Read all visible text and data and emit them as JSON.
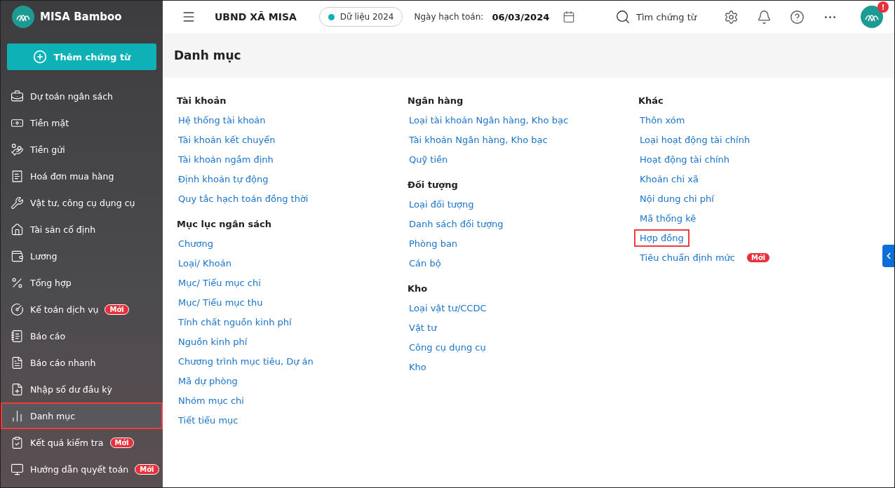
{
  "sidebar": {
    "brand": "MISA Bamboo",
    "add_button": "Thêm chứng từ",
    "items": [
      {
        "label": "Dự toán ngân sách",
        "selected": false,
        "highlighted": false
      },
      {
        "label": "Tiền mặt",
        "selected": false,
        "highlighted": false
      },
      {
        "label": "Tiền gửi",
        "selected": false,
        "highlighted": false
      },
      {
        "label": "Hoá đơn mua hàng",
        "selected": false,
        "highlighted": false
      },
      {
        "label": "Vật tư, công cụ dụng cụ",
        "selected": false,
        "highlighted": false
      },
      {
        "label": "Tài sản cố định",
        "selected": false,
        "highlighted": false
      },
      {
        "label": "Lương",
        "selected": false,
        "highlighted": false
      },
      {
        "label": "Tổng hợp",
        "selected": false,
        "highlighted": false
      },
      {
        "label": "Kế toán dịch vụ",
        "badge": "Mới",
        "selected": false,
        "highlighted": false
      },
      {
        "label": "Báo cáo",
        "selected": false,
        "highlighted": false
      },
      {
        "label": "Báo cáo nhanh",
        "selected": false,
        "highlighted": false
      },
      {
        "label": "Nhập số dư đầu kỳ",
        "selected": false,
        "highlighted": false
      },
      {
        "label": "Danh mục",
        "selected": true,
        "highlighted": true
      },
      {
        "label": "Kết quả kiểm tra",
        "badge": "Mới",
        "selected": false,
        "highlighted": false
      },
      {
        "label": "Hướng dẫn quyết toán",
        "badge": "Mới",
        "selected": false,
        "highlighted": false
      }
    ]
  },
  "header": {
    "org": "UBND XÃ MISA",
    "data_year": "Dữ liệu 2024",
    "date_label": "Ngày hạch toán:",
    "date": "06/03/2024",
    "search": "Tìm chứng từ",
    "notification_alert": "!"
  },
  "page": {
    "title": "Danh mục",
    "columns": [
      {
        "groups": [
          {
            "title": "Tài khoản",
            "links": [
              {
                "label": "Hệ thống tài khoản",
                "highlighted": false
              },
              {
                "label": "Tài khoản kết chuyển",
                "highlighted": false
              },
              {
                "label": "Tài khoản ngầm định",
                "highlighted": false
              },
              {
                "label": "Định khoản tự động",
                "highlighted": false
              },
              {
                "label": "Quy tắc hạch toán đồng thời",
                "highlighted": false
              }
            ]
          },
          {
            "title": "Mục lục ngân sách",
            "links": [
              {
                "label": "Chương",
                "highlighted": false
              },
              {
                "label": "Loại/ Khoản",
                "highlighted": false
              },
              {
                "label": "Mục/ Tiểu mục chi",
                "highlighted": false
              },
              {
                "label": "Mục/ Tiểu mục thu",
                "highlighted": false
              },
              {
                "label": "Tính chất nguồn kinh phí",
                "highlighted": false
              },
              {
                "label": "Nguồn kinh phí",
                "highlighted": false
              },
              {
                "label": "Chương trình mục tiêu, Dự án",
                "highlighted": false
              },
              {
                "label": "Mã dự phòng",
                "highlighted": false
              },
              {
                "label": "Nhóm mục chi",
                "highlighted": false
              },
              {
                "label": "Tiết tiểu mục",
                "highlighted": false
              }
            ]
          }
        ]
      },
      {
        "groups": [
          {
            "title": "Ngân hàng",
            "links": [
              {
                "label": "Loại tài khoản Ngân hàng, Kho bạc",
                "highlighted": false
              },
              {
                "label": "Tài khoản Ngân hàng, Kho bạc",
                "highlighted": false
              },
              {
                "label": "Quỹ tiền",
                "highlighted": false
              }
            ]
          },
          {
            "title": "Đối tượng",
            "links": [
              {
                "label": "Loại đối tượng",
                "highlighted": false
              },
              {
                "label": "Danh sách đối tượng",
                "highlighted": false
              },
              {
                "label": "Phòng ban",
                "highlighted": false
              },
              {
                "label": "Cán bộ",
                "highlighted": false
              }
            ]
          },
          {
            "title": "Kho",
            "links": [
              {
                "label": "Loại vật tư/CCDC",
                "highlighted": false
              },
              {
                "label": "Vật tư",
                "highlighted": false
              },
              {
                "label": "Công cụ dụng cụ",
                "highlighted": false
              },
              {
                "label": "Kho",
                "highlighted": false
              }
            ]
          }
        ]
      },
      {
        "groups": [
          {
            "title": "Khác",
            "links": [
              {
                "label": "Thôn xóm",
                "highlighted": false
              },
              {
                "label": "Loại hoạt động tài chính",
                "highlighted": false
              },
              {
                "label": "Hoạt động tài chính",
                "highlighted": false
              },
              {
                "label": "Khoản chi xã",
                "highlighted": false
              },
              {
                "label": "Nội dung chi phí",
                "highlighted": false
              },
              {
                "label": "Mã thống kê",
                "highlighted": false
              },
              {
                "label": "Hợp đồng",
                "highlighted": true
              },
              {
                "label": "Tiêu chuẩn định mức",
                "badge": "Mới",
                "highlighted": false
              }
            ]
          }
        ]
      }
    ]
  }
}
